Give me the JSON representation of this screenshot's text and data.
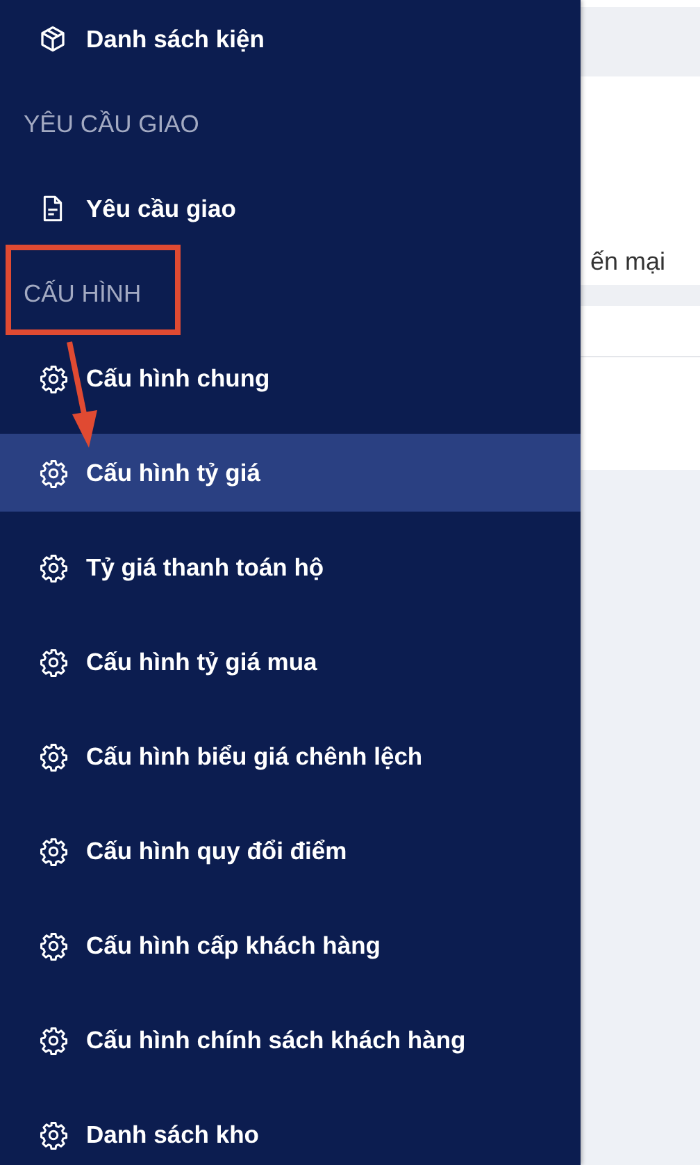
{
  "sidebar": {
    "groups": [
      {
        "items": [
          {
            "label": "Danh sách kiện",
            "kind": "cube",
            "selected": false
          }
        ]
      },
      {
        "title": "YÊU CẦU GIAO",
        "items": [
          {
            "label": "Yêu cầu giao",
            "kind": "document",
            "selected": false
          }
        ]
      },
      {
        "title": "CẤU HÌNH",
        "items": [
          {
            "label": "Cấu hình chung",
            "kind": "gear",
            "selected": false
          },
          {
            "label": "Cấu hình tỷ giá",
            "kind": "gear",
            "selected": true
          },
          {
            "label": "Tỷ giá thanh toán hộ",
            "kind": "gear",
            "selected": false
          },
          {
            "label": "Cấu hình tỷ giá mua",
            "kind": "gear",
            "selected": false
          },
          {
            "label": "Cấu hình biểu giá chênh lệch",
            "kind": "gear",
            "selected": false
          },
          {
            "label": "Cấu hình quy đổi điểm",
            "kind": "gear",
            "selected": false
          },
          {
            "label": "Cấu hình cấp khách hàng",
            "kind": "gear",
            "selected": false
          },
          {
            "label": "Cấu hình chính sách khách hàng",
            "kind": "gear",
            "selected": false
          },
          {
            "label": "Danh sách kho",
            "kind": "gear",
            "selected": false
          }
        ]
      }
    ]
  },
  "main": {
    "text": "ến mại"
  },
  "annotations": {
    "highlight_box": true,
    "arrow": true
  }
}
